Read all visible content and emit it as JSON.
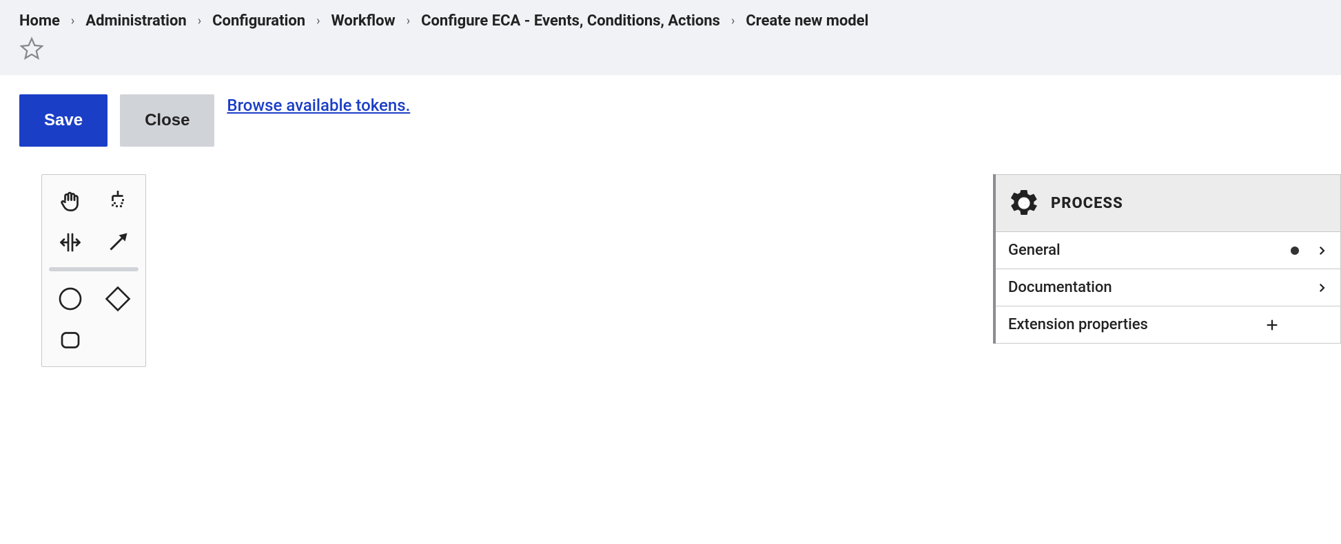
{
  "breadcrumb": [
    "Home",
    "Administration",
    "Configuration",
    "Workflow",
    "Configure ECA - Events, Conditions, Actions",
    "Create new model"
  ],
  "toolbar": {
    "save_label": "Save",
    "close_label": "Close",
    "tokens_link_label": "Browse available tokens."
  },
  "panel": {
    "title": "PROCESS",
    "sections": {
      "general": {
        "label": "General",
        "has_data": true,
        "expandable": true
      },
      "documentation": {
        "label": "Documentation",
        "has_data": false,
        "expandable": true
      },
      "extension": {
        "label": "Extension properties",
        "has_data": false,
        "addable": true
      }
    }
  }
}
